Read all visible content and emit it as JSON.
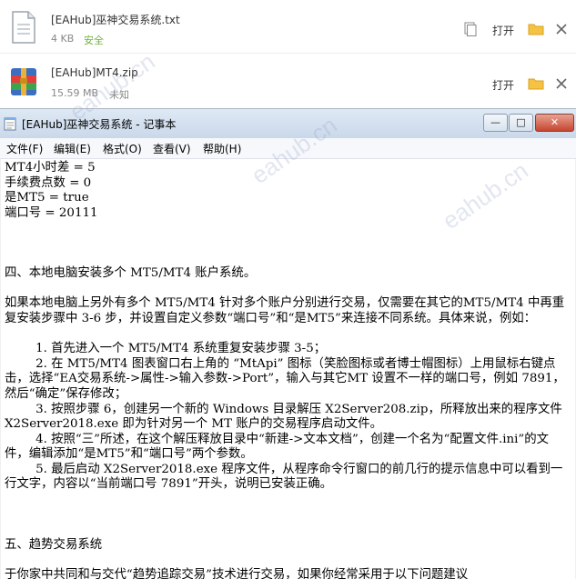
{
  "downloads": [
    {
      "name": "[EAHub]巫神交易系统.txt",
      "size": "4 KB",
      "status": "安全",
      "open_label": "打开",
      "icon": "text-file-icon"
    },
    {
      "name": "[EAHub]MT4.zip",
      "size": "15.59 MB",
      "status": "未知",
      "open_label": "打开",
      "icon": "winrar-archive-icon"
    }
  ],
  "notepad": {
    "title": "[EAHub]巫神交易系统 - 记事本",
    "window_buttons": {
      "minimize": "—",
      "maximize": "□",
      "close": "✕"
    },
    "menu": [
      "文件(F)",
      "编辑(E)",
      "格式(O)",
      "查看(V)",
      "帮助(H)"
    ],
    "lines": [
      "MT4小时差 = 5",
      "手续费点数 = 0",
      "是MT5 = true",
      "端口号 = 20111",
      "",
      "",
      "",
      "四、本地电脑安装多个 MT5/MT4 账户系统。",
      "",
      "如果本地电脑上另外有多个 MT5/MT4 针对多个账户分别进行交易，仅需要在其它的MT5/MT4 中再重复安装步骤中 3-6 步，并设置自定义参数“端口号”和“是MT5”来连接不同系统。具体来说，例如：",
      "",
      "        1. 首先进入一个 MT5/MT4 系统重复安装步骤 3-5；",
      "        2. 在 MT5/MT4 图表窗口右上角的 “MtApi” 图标（笑脸图标或者博士帽图标）上用鼠标右键点击，选择“EA交易系统->属性->输入参数->Port”，输入与其它MT 设置不一样的端口号，例如 7891，然后“确定”保存修改；",
      "        3. 按照步骤 6，创建另一个新的 Windows 目录解压 X2Server208.zip，所释放出来的程序文件 X2Server2018.exe 即为针对另一个 MT 账户的交易程序启动文件。",
      "        4. 按照“三”所述，在这个解压释放目录中“新建->文本文档”，创建一个名为“配置文件.ini”的文件，编辑添加“是MT5”和“端口号”两个参数。",
      "        5. 最后启动 X2Server2018.exe 程序文件，从程序命令行窗口的前几行的提示信息中可以看到一行文字，内容以“当前端口号 7891”开头，说明已安装正确。",
      "",
      "",
      "",
      "五、趋势交易系统",
      "",
      "于你家中共同和与交代“趋势追踪交易”技术进行交易，如果你经常采用于以下问题建议"
    ]
  },
  "watermark": "eahub.cn",
  "colors": {
    "safe_status": "#6fb43f",
    "title_gradient_top": "#dfe9f5",
    "close_button": "#c6452f"
  }
}
